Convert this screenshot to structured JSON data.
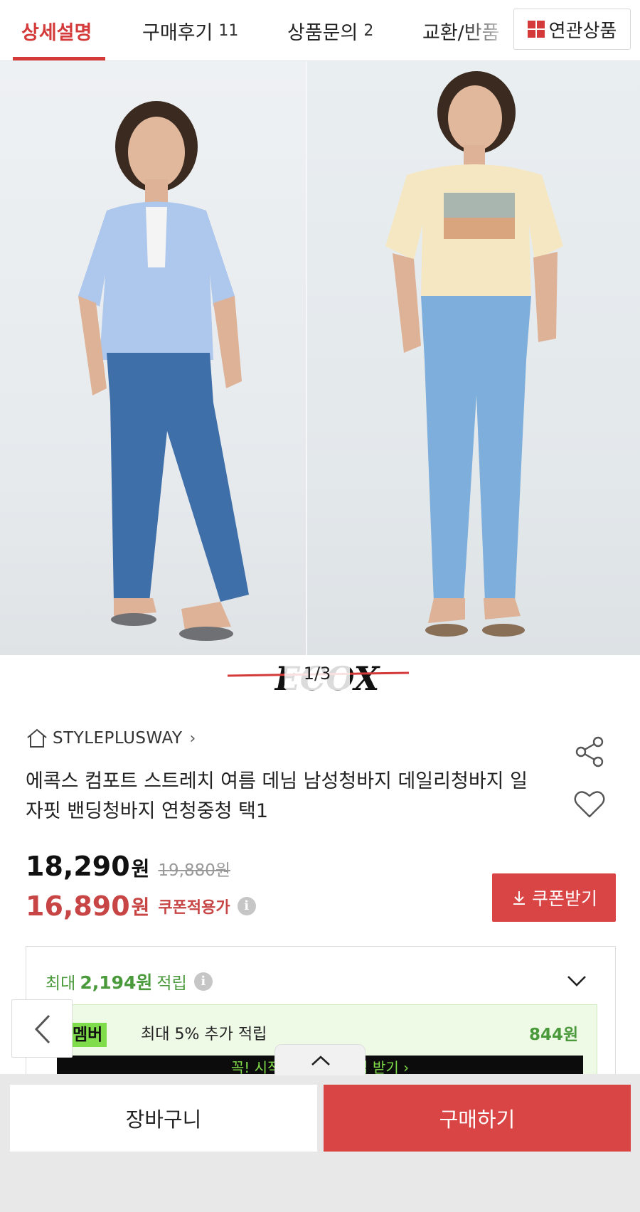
{
  "tabs": [
    {
      "label": "상세설명",
      "count": ""
    },
    {
      "label": "구매후기",
      "count": "11"
    },
    {
      "label": "상품문의",
      "count": "2"
    },
    {
      "label": "교환/반품",
      "count": ""
    }
  ],
  "related_button": "연관상품",
  "gallery": {
    "pager": "1/3",
    "logo_text": "ECOX"
  },
  "store": {
    "name": "STYLEPLUSWAY",
    "chevron": "›"
  },
  "product": {
    "title": "에콕스 컴포트 스트레치 여름 데님 남성청바지 데일리청바지 일자핏 밴딩청바지 연청중청 택1"
  },
  "price": {
    "sale": "18,290",
    "won": "원",
    "original": "19,880원",
    "coupon_price": "16,890",
    "coupon_note": "쿠폰적용가",
    "info_glyph": "i"
  },
  "coupon_button": "쿠폰받기",
  "points": {
    "prefix": "최대",
    "amount": "2,194원",
    "suffix": "적립",
    "member_badge": "멤버",
    "member_text": "최대 5% 추가 적립",
    "member_amount": "844원",
    "banner_text": "꼭! 시작하고 추가 적립 받기 ›"
  },
  "bottom": {
    "cart": "장바구니",
    "buy": "구매하기"
  },
  "colors": {
    "accent": "#d94444",
    "green": "#4a9a3c",
    "member_green": "#7fdc4a"
  }
}
